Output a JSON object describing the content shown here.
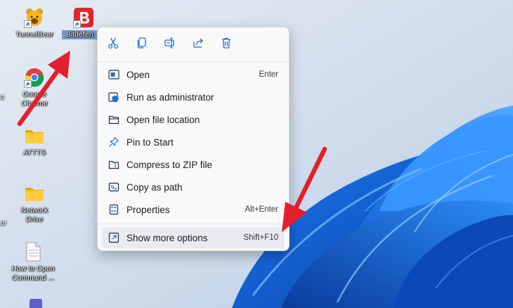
{
  "desktop": {
    "icons": [
      {
        "label": "TunnelBear",
        "icon": "bear-icon"
      },
      {
        "label": "Bitdefen",
        "icon": "bitdefender-icon"
      },
      {
        "label": "Google Chrome",
        "icon": "chrome-icon"
      },
      {
        "label": "ATTTS",
        "icon": "folder-icon"
      },
      {
        "label": "Network Drive",
        "icon": "folder-icon"
      },
      {
        "label": "How to Open Command ...",
        "icon": "document-icon"
      }
    ],
    "edge_left_1": "o",
    "edge_left_2": "er"
  },
  "context_menu": {
    "quick_actions": [
      "Cut",
      "Copy",
      "Rename",
      "Share",
      "Delete"
    ],
    "items": [
      {
        "label": "Open",
        "accel": "Enter",
        "icon": "open-app-icon"
      },
      {
        "label": "Run as administrator",
        "accel": "",
        "icon": "shield-admin-icon"
      },
      {
        "label": "Open file location",
        "accel": "",
        "icon": "folder-outline-icon"
      },
      {
        "label": "Pin to Start",
        "accel": "",
        "icon": "pin-icon"
      },
      {
        "label": "Compress to ZIP file",
        "accel": "",
        "icon": "zip-icon"
      },
      {
        "label": "Copy as path",
        "accel": "",
        "icon": "copy-path-icon"
      },
      {
        "label": "Properties",
        "accel": "Alt+Enter",
        "icon": "properties-icon"
      }
    ],
    "more": {
      "label": "Show more options",
      "accel": "Shift+F10",
      "icon": "show-more-icon"
    }
  },
  "colors": {
    "accent": "#1f6fce",
    "annotation_arrow": "#e3202b",
    "bitdefender_red": "#e5232d"
  }
}
